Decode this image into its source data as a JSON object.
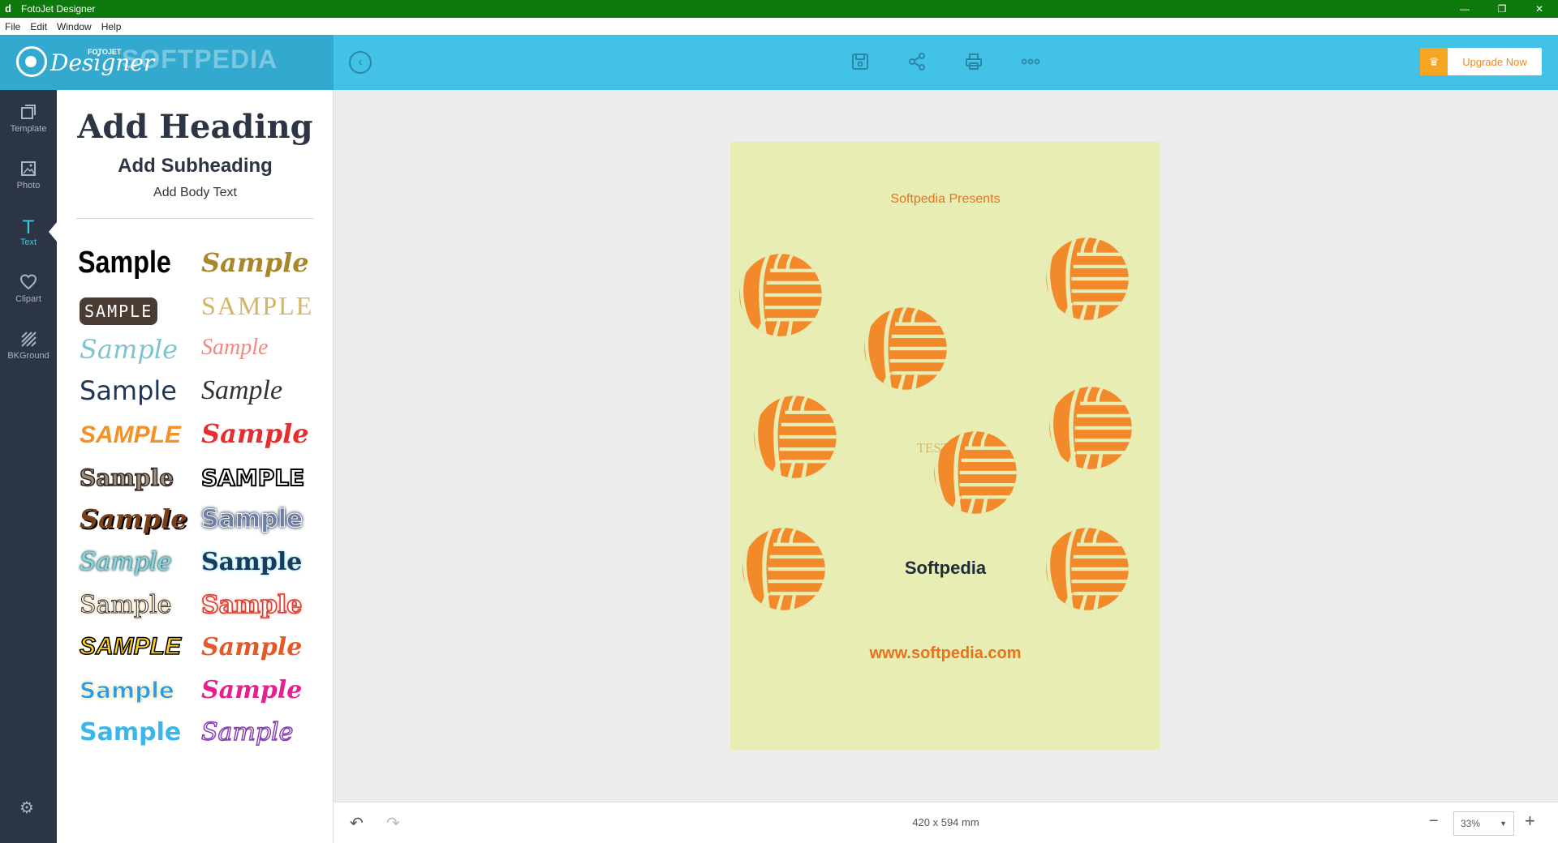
{
  "window": {
    "title": "FotoJet Designer",
    "minimize": "—",
    "restore": "❐",
    "close": "✕"
  },
  "menu": [
    "File",
    "Edit",
    "Window",
    "Help"
  ],
  "header": {
    "logo_text": "Designer",
    "logo_small": "FOTOJET",
    "logo_watermark": "SOFTPEDIA",
    "upgrade_label": "Upgrade Now"
  },
  "rail": {
    "items": [
      {
        "label": "Template",
        "icon": "template-icon"
      },
      {
        "label": "Photo",
        "icon": "photo-icon"
      },
      {
        "label": "Text",
        "icon": "text-icon"
      },
      {
        "label": "Clipart",
        "icon": "heart-icon"
      },
      {
        "label": "BKGround",
        "icon": "background-icon"
      }
    ],
    "active": "Text"
  },
  "panel": {
    "heading": "Add Heading",
    "subheading": "Add Subheading",
    "body": "Add Body Text",
    "samples": [
      "Sample",
      "Sample",
      "SAMPLE",
      "SAMPLE",
      "Sample",
      "Sample",
      "Sample",
      "Sample",
      "SAMPLE",
      "Sample",
      "Sample",
      "SAMPLE",
      "Sample",
      "Sample",
      "Sample",
      "Sample",
      "Sample",
      "Sample",
      "SAMPLE",
      "Sample",
      "Sample",
      "Sample",
      "Sample",
      "Sample"
    ]
  },
  "poster": {
    "presents": "Softpedia Presents",
    "watermark": "TESTING",
    "name": "Softpedia",
    "url": "www.softpedia.com",
    "background": "#e8edb4",
    "ball_color": "#f2892a"
  },
  "bottom": {
    "dimensions": "420 x 594 mm",
    "zoom": "33%"
  },
  "colors": {
    "titlebar": "#0e7a0d",
    "header": "#42c2e6",
    "rail": "#2c3544",
    "accent": "#42c2e6",
    "upgrade": "#f6a623"
  }
}
